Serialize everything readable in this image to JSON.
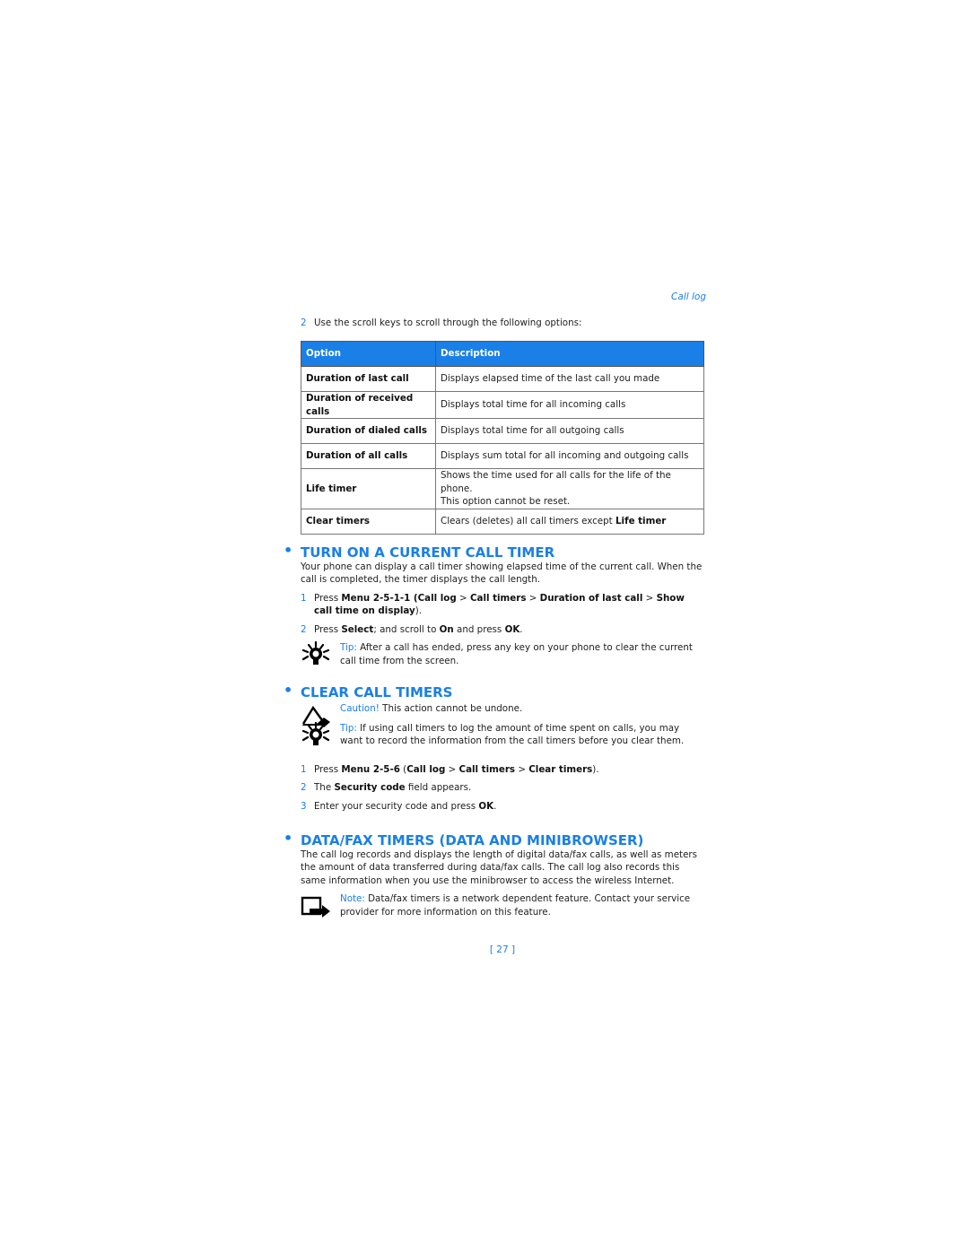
{
  "header": {
    "section": "Call log"
  },
  "intro_step": {
    "num": "2",
    "text": "Use the scroll keys to scroll through the following options:"
  },
  "table": {
    "headers": [
      "Option",
      "Description"
    ],
    "rows": [
      {
        "option": "Duration of last call",
        "description": "Displays elapsed time of the last call you made"
      },
      {
        "option": "Duration of received calls",
        "description": "Displays total time for all incoming calls"
      },
      {
        "option": "Duration of dialed calls",
        "description": "Displays total time for all outgoing calls"
      },
      {
        "option": "Duration of all calls",
        "description": "Displays sum total for all incoming and outgoing calls"
      },
      {
        "option": "Life timer",
        "description_line1": "Shows the time used for all calls for the life of the phone.",
        "description_line2": "This option cannot be reset."
      },
      {
        "option": "Clear timers",
        "description_pre": "Clears (deletes) all call timers except ",
        "description_bold": "Life timer"
      }
    ]
  },
  "section1": {
    "bullet": "•",
    "title": "TURN ON A CURRENT CALL TIMER",
    "para": "Your phone can display a call timer showing elapsed time of the current call. When the call is completed, the timer displays the call length.",
    "step1": {
      "num": "1",
      "t1": "Press ",
      "b1": "Menu 2-5-1-1 (Call log",
      "t2": " > ",
      "b2": "Call timers",
      "t3": " > ",
      "b3": "Duration of last call",
      "t4": " > ",
      "b4": "Show call time on display",
      "t5": ")."
    },
    "step2": {
      "num": "2",
      "t1": "Press ",
      "b1": "Select",
      "t2": "; and scroll to ",
      "b2": "On",
      "t3": " and press ",
      "b3": "OK",
      "t4": "."
    },
    "tip": {
      "label": "Tip:",
      "text": " After a call has ended, press any key on your phone to clear the current call time from the screen."
    }
  },
  "section2": {
    "bullet": "•",
    "title": "CLEAR CALL TIMERS",
    "caution": {
      "label": "Caution!",
      "text": " This action cannot be undone."
    },
    "tip": {
      "label": "Tip:",
      "text": " If using call timers to log the amount of time spent on calls, you may want to record the information from the call timers before you clear them."
    },
    "step1": {
      "num": "1",
      "t1": "Press ",
      "b1": "Menu 2-5-6",
      "t2": " (",
      "b2": "Call log",
      "t3": " > ",
      "b3": "Call timers",
      "t4": " > ",
      "b4": "Clear timers",
      "t5": ")."
    },
    "step2": {
      "num": "2",
      "t1": "The ",
      "b1": "Security code",
      "t2": " field appears."
    },
    "step3": {
      "num": "3",
      "t1": "Enter your security code and press ",
      "b1": "OK",
      "t2": "."
    }
  },
  "section3": {
    "bullet": "•",
    "title": "DATA/FAX TIMERS (DATA AND MINIBROWSER)",
    "para": "The call log records and displays the length of digital data/fax calls, as well as meters the amount of data transferred during data/fax calls. The call log also records this same information when you use the minibrowser to access the wireless Internet.",
    "note": {
      "label": "Note:",
      "text": " Data/fax timers is a network dependent feature. Contact your service provider for more information on this feature."
    }
  },
  "footer": {
    "page": "[ 27 ]"
  }
}
